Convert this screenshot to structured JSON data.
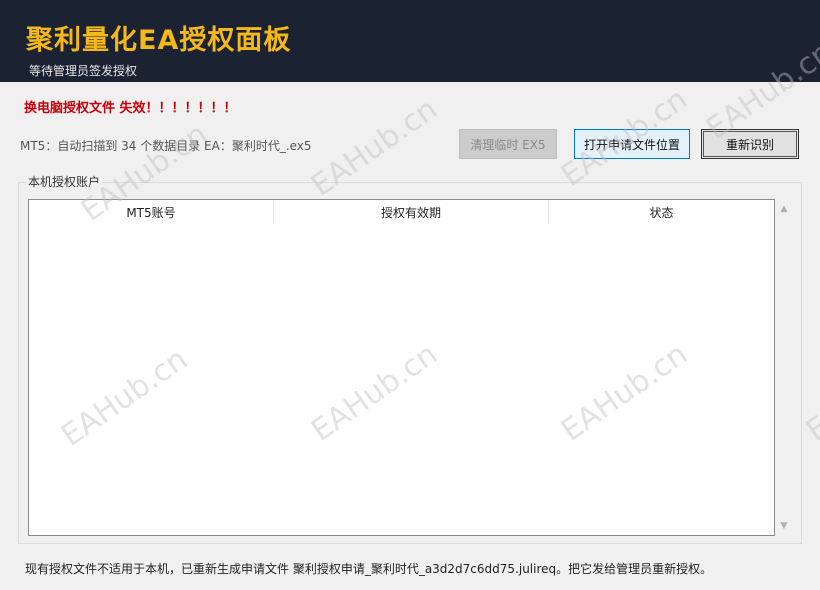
{
  "header": {
    "title": "聚利量化EA授权面板",
    "subtitle": "等待管理员签发授权"
  },
  "status": {
    "error_message": "换电脑授权文件 失效！！！！！！！",
    "scan_info": "MT5：自动扫描到 34 个数据目录   EA：聚利时代_.ex5"
  },
  "toolbar": {
    "clean_label": "清理临时 EX5",
    "open_label": "打开申请文件位置",
    "rescan_label": "重新识别"
  },
  "accounts": {
    "group_title": "本机授权账户",
    "columns": [
      "MT5账号",
      "授权有效期",
      "状态"
    ],
    "rows": []
  },
  "footer": {
    "note": "现有授权文件不适用于本机，已重新生成申请文件 聚利授权申请_聚利时代_a3d2d7c6dd75.julireq。把它发给管理员重新授权。"
  },
  "watermark": {
    "text": "EAHub.cn"
  },
  "colors": {
    "header_bg": "#1b2232",
    "title": "#f5b81c",
    "error": "#c8000a",
    "accent": "#0078d4"
  }
}
